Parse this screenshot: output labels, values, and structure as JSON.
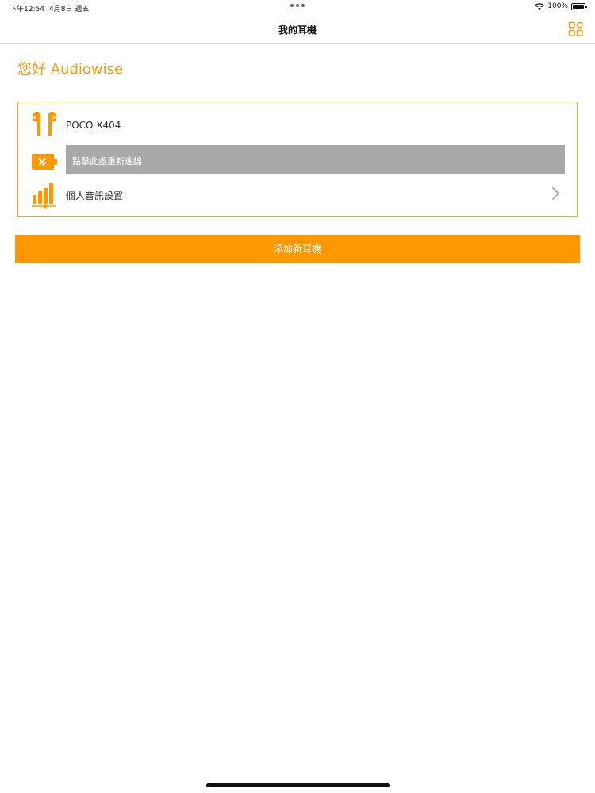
{
  "status_bar": {
    "time": "下午12:54",
    "date": "4月8日 週五",
    "battery": "100%",
    "wifi_icon": "wifi-icon",
    "battery_icon": "battery-icon"
  },
  "nav": {
    "title": "我的耳機",
    "grid_icon": "grid-icon"
  },
  "greeting": "您好 Audiowise",
  "device": {
    "name": "POCO X404",
    "reconnect_text": "點擊此處重新連線",
    "settings_label": "個人音訊設置",
    "earbuds_icon": "earbuds-icon",
    "battery_icon": "battery-charging-icon",
    "equalizer_icon": "equalizer-icon",
    "chevron_icon": "chevron-right-icon"
  },
  "add_button_label": "添加新耳機",
  "colors": {
    "accent": "#ff9800",
    "card_border": "#f5a623",
    "reconnect_bg": "#a9a9ab"
  }
}
